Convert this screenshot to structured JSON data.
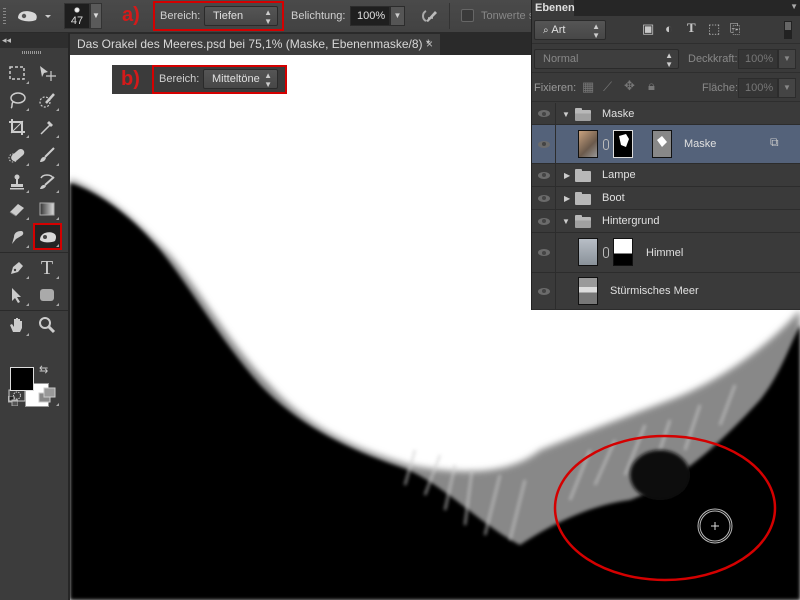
{
  "options_bar": {
    "tool_preset_icon": "sponge-tool-icon",
    "brush_size": "47",
    "annotation_a": "a)",
    "range_label": "Bereich:",
    "range_value": "Tiefen",
    "exposure_label": "Belichtung:",
    "exposure_value": "100%",
    "airbrush_icon": "airbrush-icon",
    "protect_tones_label": "Tonwerte s",
    "protect_tones_checked": false
  },
  "overlay_b": {
    "annotation_b": "b)",
    "range_label": "Bereich:",
    "range_value": "Mitteltöne"
  },
  "document": {
    "tab_title": "Das Orakel des Meeres.psd bei 75,1% (Maske, Ebenenmaske/8) *",
    "close_glyph": "×"
  },
  "toolbar": {
    "collapse_glyph": "◂◂",
    "tools": [
      {
        "name": "rectangular-marquee-tool"
      },
      {
        "name": "move-tool"
      },
      {
        "name": "lasso-tool"
      },
      {
        "name": "quick-selection-tool"
      },
      {
        "name": "crop-tool"
      },
      {
        "name": "eyedropper-tool"
      },
      {
        "name": "spot-healing-brush-tool"
      },
      {
        "name": "brush-tool"
      },
      {
        "name": "clone-stamp-tool"
      },
      {
        "name": "history-brush-tool"
      },
      {
        "name": "eraser-tool"
      },
      {
        "name": "gradient-tool"
      },
      {
        "name": "smudge-tool"
      },
      {
        "name": "dodge-burn-sponge-tool",
        "active": true
      },
      {
        "name": "pen-tool"
      },
      {
        "name": "type-tool",
        "glyph": "T"
      },
      {
        "name": "path-selection-tool"
      },
      {
        "name": "rectangle-tool"
      },
      {
        "name": "hand-tool"
      },
      {
        "name": "zoom-tool"
      }
    ],
    "foreground_color": "#000000",
    "background_color": "#ffffff"
  },
  "layers_panel": {
    "tab_label": "Ebenen",
    "filter_kind": "Art",
    "blend_mode": "Normal",
    "opacity_label": "Deckkraft:",
    "opacity_value": "100%",
    "lock_label": "Fixieren:",
    "fill_label": "Fläche:",
    "fill_value": "100%",
    "layers": [
      {
        "name": "Maske",
        "type": "group",
        "expanded": true,
        "visible": true
      },
      {
        "name": "Maske",
        "type": "layer",
        "selected": true,
        "has_mask": true,
        "visible": true
      },
      {
        "name": "Lampe",
        "type": "group",
        "expanded": false,
        "visible": true
      },
      {
        "name": "Boot",
        "type": "group",
        "expanded": false,
        "visible": true
      },
      {
        "name": "Hintergrund",
        "type": "group",
        "expanded": true,
        "visible": true
      },
      {
        "name": "Himmel",
        "type": "layer",
        "has_mask": true,
        "visible": true
      },
      {
        "name": "Stürmisches Meer",
        "type": "layer",
        "visible": true
      }
    ]
  },
  "colors": {
    "annotation_red": "#d40000",
    "selected_layer": "#54627a",
    "panel_bg": "#3a3a3a"
  }
}
